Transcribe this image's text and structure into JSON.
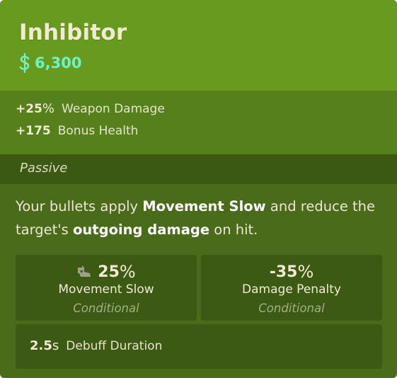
{
  "item": {
    "name": "Inhibitor",
    "cost": "6,300",
    "cost_icon": "souls-currency-icon"
  },
  "stats": [
    {
      "value": "+25",
      "unit": "%",
      "label": "Weapon Damage"
    },
    {
      "value": "+175",
      "unit": "",
      "label": "Bonus Health"
    }
  ],
  "passive": {
    "header": "Passive",
    "desc_pre": "Your bullets apply ",
    "desc_b1": "Movement Slow",
    "desc_mid": " and reduce the target's ",
    "desc_b2": "outgoing damage",
    "desc_post": " on hit."
  },
  "boxes": [
    {
      "icon": "movement-slow-icon",
      "value": "25",
      "unit": "%",
      "label": "Movement Slow",
      "note": "Conditional"
    },
    {
      "value": "-35",
      "unit": "%",
      "label": "Damage Penalty",
      "note": "Conditional"
    }
  ],
  "duration": {
    "value": "2.5",
    "unit": "s",
    "label": "Debuff Duration"
  },
  "colors": {
    "header_bg": "#679a1f",
    "stats_bg": "#55801c",
    "passive_bar_bg": "#3c5914",
    "body_bg": "#4a6b1a",
    "box_bg": "#3d5a14",
    "cost_color": "#6ff2c4",
    "title_color": "#f3ead0"
  }
}
